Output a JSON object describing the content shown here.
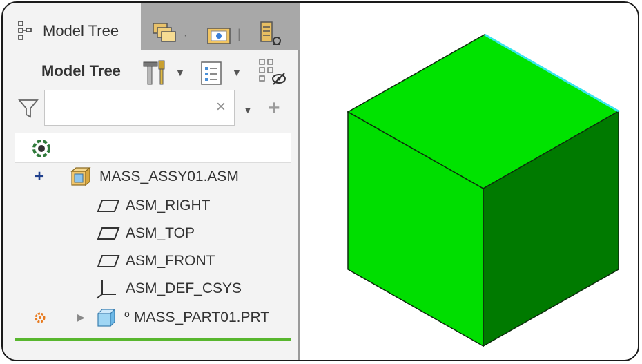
{
  "tabs": [
    {
      "label": "Model Tree",
      "icon": "model-tree-icon"
    },
    {
      "icon": "layers-icon"
    },
    {
      "icon": "folder-browser-icon"
    },
    {
      "icon": "favorites-icon"
    }
  ],
  "toolbar": {
    "title": "Model Tree",
    "settings_icon": "tools-icon",
    "columns_icon": "tree-columns-icon",
    "show_icon": "show-hide-icon"
  },
  "search": {
    "value": "",
    "placeholder": "",
    "clear_icon": "close-icon",
    "add_icon": "plus-icon"
  },
  "tree": {
    "items": [
      {
        "label": "MASS_ASSY01.ASM",
        "icon": "assembly-icon",
        "marker": "plus-icon"
      },
      {
        "label": "ASM_RIGHT",
        "icon": "datum-plane-icon"
      },
      {
        "label": "ASM_TOP",
        "icon": "datum-plane-icon"
      },
      {
        "label": "ASM_FRONT",
        "icon": "datum-plane-icon"
      },
      {
        "label": "ASM_DEF_CSYS",
        "icon": "csys-icon"
      },
      {
        "label": "MASS_PART01.PRT",
        "icon": "part-icon",
        "marker": "regen-star-icon",
        "status_glyph": "ᴏ"
      }
    ]
  },
  "colors": {
    "model_face_top": "#00e300",
    "model_face_left": "#00de00",
    "model_face_right": "#007a00",
    "edge_highlight": "#37e6ee",
    "status_green": "#58b62e"
  }
}
